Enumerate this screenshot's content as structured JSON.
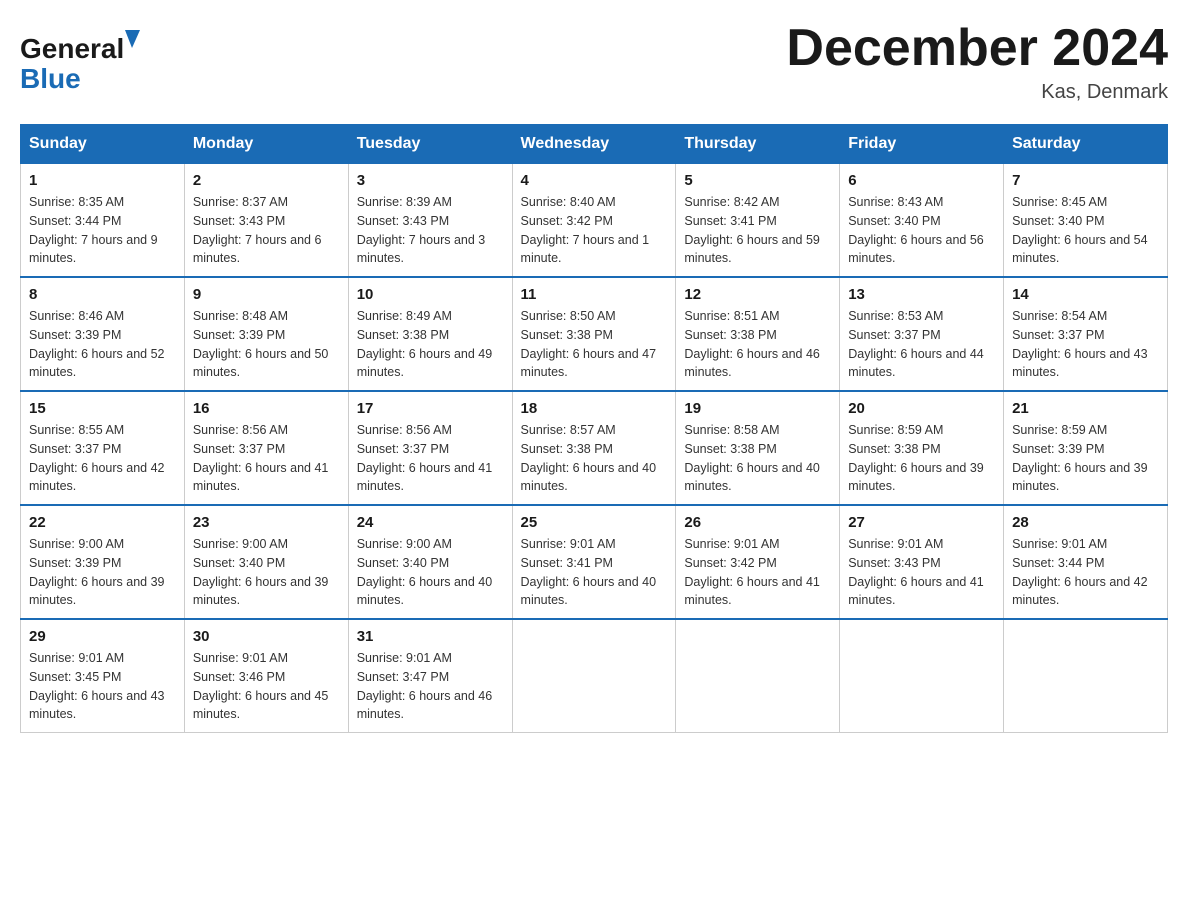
{
  "header": {
    "title": "December 2024",
    "subtitle": "Kas, Denmark",
    "logo_general": "General",
    "logo_blue": "Blue"
  },
  "calendar": {
    "weekdays": [
      "Sunday",
      "Monday",
      "Tuesday",
      "Wednesday",
      "Thursday",
      "Friday",
      "Saturday"
    ],
    "weeks": [
      [
        {
          "day": 1,
          "sunrise": "8:35 AM",
          "sunset": "3:44 PM",
          "daylight": "7 hours and 9 minutes."
        },
        {
          "day": 2,
          "sunrise": "8:37 AM",
          "sunset": "3:43 PM",
          "daylight": "7 hours and 6 minutes."
        },
        {
          "day": 3,
          "sunrise": "8:39 AM",
          "sunset": "3:43 PM",
          "daylight": "7 hours and 3 minutes."
        },
        {
          "day": 4,
          "sunrise": "8:40 AM",
          "sunset": "3:42 PM",
          "daylight": "7 hours and 1 minute."
        },
        {
          "day": 5,
          "sunrise": "8:42 AM",
          "sunset": "3:41 PM",
          "daylight": "6 hours and 59 minutes."
        },
        {
          "day": 6,
          "sunrise": "8:43 AM",
          "sunset": "3:40 PM",
          "daylight": "6 hours and 56 minutes."
        },
        {
          "day": 7,
          "sunrise": "8:45 AM",
          "sunset": "3:40 PM",
          "daylight": "6 hours and 54 minutes."
        }
      ],
      [
        {
          "day": 8,
          "sunrise": "8:46 AM",
          "sunset": "3:39 PM",
          "daylight": "6 hours and 52 minutes."
        },
        {
          "day": 9,
          "sunrise": "8:48 AM",
          "sunset": "3:39 PM",
          "daylight": "6 hours and 50 minutes."
        },
        {
          "day": 10,
          "sunrise": "8:49 AM",
          "sunset": "3:38 PM",
          "daylight": "6 hours and 49 minutes."
        },
        {
          "day": 11,
          "sunrise": "8:50 AM",
          "sunset": "3:38 PM",
          "daylight": "6 hours and 47 minutes."
        },
        {
          "day": 12,
          "sunrise": "8:51 AM",
          "sunset": "3:38 PM",
          "daylight": "6 hours and 46 minutes."
        },
        {
          "day": 13,
          "sunrise": "8:53 AM",
          "sunset": "3:37 PM",
          "daylight": "6 hours and 44 minutes."
        },
        {
          "day": 14,
          "sunrise": "8:54 AM",
          "sunset": "3:37 PM",
          "daylight": "6 hours and 43 minutes."
        }
      ],
      [
        {
          "day": 15,
          "sunrise": "8:55 AM",
          "sunset": "3:37 PM",
          "daylight": "6 hours and 42 minutes."
        },
        {
          "day": 16,
          "sunrise": "8:56 AM",
          "sunset": "3:37 PM",
          "daylight": "6 hours and 41 minutes."
        },
        {
          "day": 17,
          "sunrise": "8:56 AM",
          "sunset": "3:37 PM",
          "daylight": "6 hours and 41 minutes."
        },
        {
          "day": 18,
          "sunrise": "8:57 AM",
          "sunset": "3:38 PM",
          "daylight": "6 hours and 40 minutes."
        },
        {
          "day": 19,
          "sunrise": "8:58 AM",
          "sunset": "3:38 PM",
          "daylight": "6 hours and 40 minutes."
        },
        {
          "day": 20,
          "sunrise": "8:59 AM",
          "sunset": "3:38 PM",
          "daylight": "6 hours and 39 minutes."
        },
        {
          "day": 21,
          "sunrise": "8:59 AM",
          "sunset": "3:39 PM",
          "daylight": "6 hours and 39 minutes."
        }
      ],
      [
        {
          "day": 22,
          "sunrise": "9:00 AM",
          "sunset": "3:39 PM",
          "daylight": "6 hours and 39 minutes."
        },
        {
          "day": 23,
          "sunrise": "9:00 AM",
          "sunset": "3:40 PM",
          "daylight": "6 hours and 39 minutes."
        },
        {
          "day": 24,
          "sunrise": "9:00 AM",
          "sunset": "3:40 PM",
          "daylight": "6 hours and 40 minutes."
        },
        {
          "day": 25,
          "sunrise": "9:01 AM",
          "sunset": "3:41 PM",
          "daylight": "6 hours and 40 minutes."
        },
        {
          "day": 26,
          "sunrise": "9:01 AM",
          "sunset": "3:42 PM",
          "daylight": "6 hours and 41 minutes."
        },
        {
          "day": 27,
          "sunrise": "9:01 AM",
          "sunset": "3:43 PM",
          "daylight": "6 hours and 41 minutes."
        },
        {
          "day": 28,
          "sunrise": "9:01 AM",
          "sunset": "3:44 PM",
          "daylight": "6 hours and 42 minutes."
        }
      ],
      [
        {
          "day": 29,
          "sunrise": "9:01 AM",
          "sunset": "3:45 PM",
          "daylight": "6 hours and 43 minutes."
        },
        {
          "day": 30,
          "sunrise": "9:01 AM",
          "sunset": "3:46 PM",
          "daylight": "6 hours and 45 minutes."
        },
        {
          "day": 31,
          "sunrise": "9:01 AM",
          "sunset": "3:47 PM",
          "daylight": "6 hours and 46 minutes."
        },
        null,
        null,
        null,
        null
      ]
    ],
    "labels": {
      "sunrise": "Sunrise:",
      "sunset": "Sunset:",
      "daylight": "Daylight:"
    }
  }
}
